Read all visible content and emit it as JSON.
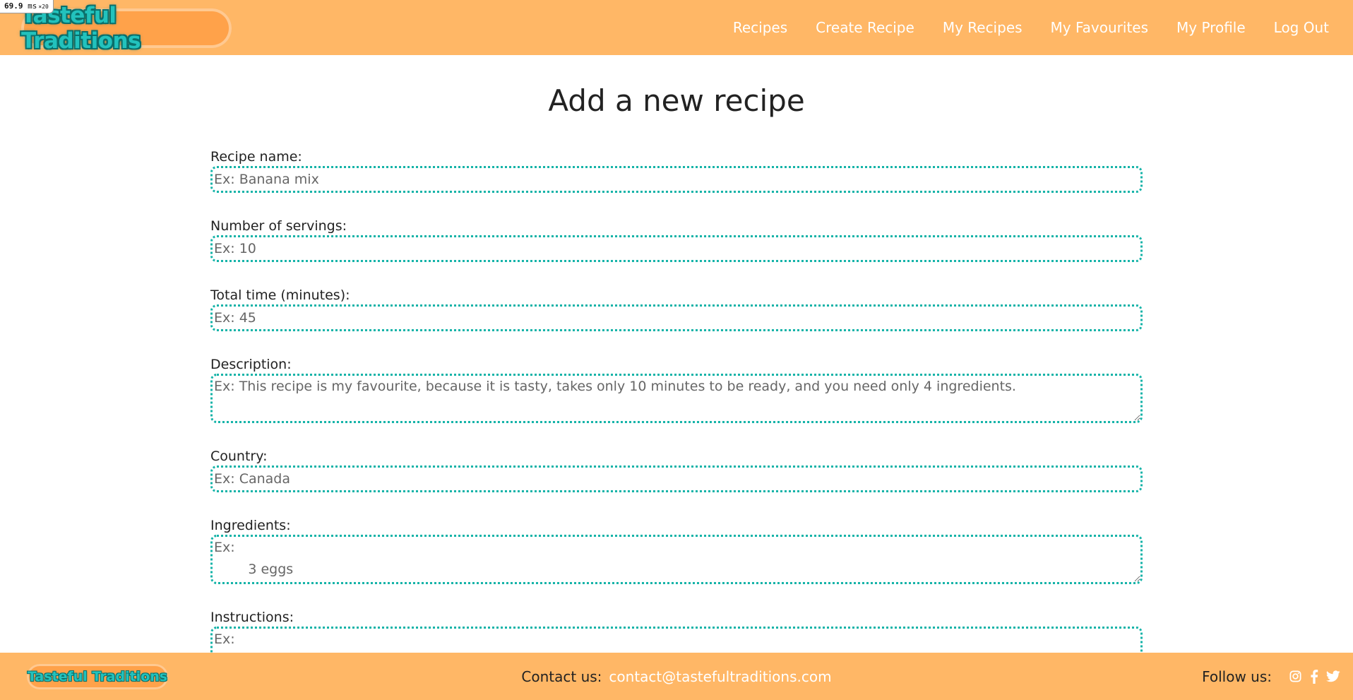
{
  "perf": {
    "value": "69.9",
    "unit": "ms",
    "multiplier": "×20"
  },
  "header": {
    "logo_text": "Tasteful Traditions",
    "nav": [
      "Recipes",
      "Create Recipe",
      "My Recipes",
      "My Favourites",
      "My Profile",
      "Log Out"
    ]
  },
  "page": {
    "title": "Add a new recipe"
  },
  "form": {
    "recipe_name": {
      "label": "Recipe name:",
      "placeholder": "Ex: Banana mix"
    },
    "servings": {
      "label": "Number of servings:",
      "placeholder": "Ex: 10"
    },
    "total_time": {
      "label": "Total time (minutes):",
      "placeholder": "Ex: 45"
    },
    "description": {
      "label": "Description:",
      "placeholder": "Ex: This recipe is my favourite, because it is tasty, takes only 10 minutes to be ready, and you need only 4 ingredients."
    },
    "country": {
      "label": "Country:",
      "placeholder": "Ex: Canada"
    },
    "ingredients": {
      "label": "Ingredients:",
      "placeholder_line1": "Ex:",
      "placeholder_line2": "        3 eggs"
    },
    "instructions": {
      "label": "Instructions:",
      "placeholder_line1": "Ex:"
    }
  },
  "footer": {
    "logo_text": "Tasteful Traditions",
    "contact_label": "Contact us:",
    "contact_email": "contact@tastefultraditions.com",
    "follow_label": "Follow us:",
    "social_icons": [
      "instagram-icon",
      "facebook-icon",
      "twitter-icon"
    ]
  },
  "colors": {
    "brand_orange": "#ffb766",
    "accent_teal": "#14b3a8",
    "white": "#ffffff"
  }
}
